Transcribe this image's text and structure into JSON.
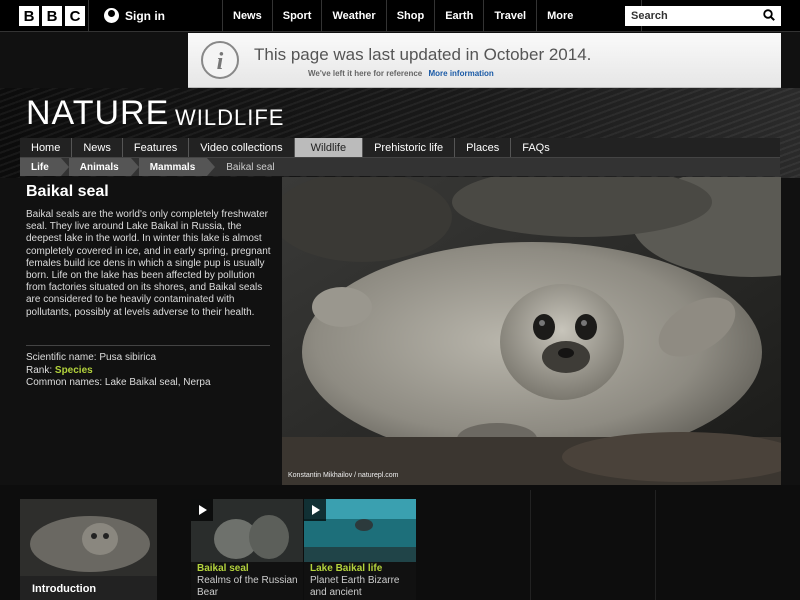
{
  "brand": {
    "letters": [
      "B",
      "B",
      "C"
    ]
  },
  "header": {
    "signin_label": "Sign in",
    "nav": [
      "News",
      "Sport",
      "Weather",
      "Shop",
      "Earth",
      "Travel"
    ],
    "more_label": "More",
    "search_placeholder": "Search"
  },
  "notice": {
    "title": "This page was last updated in October 2014.",
    "subtitle": "We've left it here for reference",
    "link": "More information"
  },
  "masthead": {
    "title": "NATURE",
    "subtitle": "WILDLIFE"
  },
  "subnav": {
    "items": [
      "Home",
      "News",
      "Features",
      "Video collections",
      "Wildlife",
      "Prehistoric life",
      "Places",
      "FAQs"
    ],
    "active_index": 4
  },
  "breadcrumb": [
    "Life",
    "Animals",
    "Mammals",
    "Baikal seal"
  ],
  "species": {
    "title": "Baikal seal",
    "description": "Baikal seals are the world's only completely freshwater seal. They live around Lake Baikal in Russia, the deepest lake in the world. In winter this lake is almost completely covered in ice, and in early spring, pregnant females build ice dens in which a single pup is usually born. Life on the lake has been affected by pollution from factories situated on its shores, and Baikal seals are considered to be heavily contaminated with pollutants, possibly at levels adverse to their health.",
    "scientific_label": "Scientific name:",
    "scientific_name": "Pusa sibirica",
    "rank_label": "Rank:",
    "rank": "Species",
    "common_label": "Common names:",
    "common_names": "Lake Baikal seal, Nerpa"
  },
  "image_credit": "Konstantin Mikhailov / naturepl.com",
  "bottom": {
    "intro_label": "Introduction",
    "videos": [
      {
        "title": "Baikal seal",
        "subtitle": "Realms of the Russian Bear"
      },
      {
        "title": "Lake Baikal life",
        "subtitle": "Planet Earth Bizarre and ancient"
      }
    ]
  },
  "colors": {
    "accent": "#b3d23c",
    "link": "#1a5aa6",
    "background": "#111111"
  }
}
